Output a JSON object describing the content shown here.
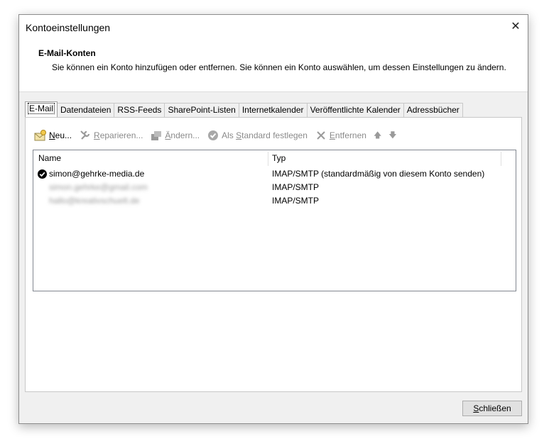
{
  "window": {
    "title": "Kontoeinstellungen",
    "close_glyph": "✕"
  },
  "header": {
    "title": "E-Mail-Konten",
    "description": "Sie können ein Konto hinzufügen oder entfernen. Sie können ein Konto auswählen, um dessen Einstellungen zu ändern."
  },
  "tabs": [
    {
      "label": "E-Mail",
      "active": true
    },
    {
      "label": "Datendateien"
    },
    {
      "label": "RSS-Feeds"
    },
    {
      "label": "SharePoint-Listen"
    },
    {
      "label": "Internetkalender"
    },
    {
      "label": "Veröffentlichte Kalender"
    },
    {
      "label": "Adressbücher"
    }
  ],
  "toolbar": {
    "new": {
      "ul": "N",
      "rest": "eu...",
      "icon": "new-account-icon",
      "enabled": true
    },
    "repair": {
      "ul": "R",
      "rest": "eparieren...",
      "icon": "wrench-icon",
      "enabled": false
    },
    "change": {
      "pre": "",
      "ul": "Ä",
      "rest": "ndern...",
      "icon": "change-icon",
      "enabled": false
    },
    "default": {
      "pre": "Als ",
      "ul": "S",
      "rest": "tandard festlegen",
      "icon": "checkmark-circle-icon",
      "enabled": false
    },
    "remove": {
      "ul": "E",
      "rest": "ntfernen",
      "icon": "x-icon",
      "enabled": false
    },
    "up_glyph": "🡅",
    "down_glyph": "🡇"
  },
  "list": {
    "columns": [
      "Name",
      "Typ"
    ],
    "rows": [
      {
        "name": "simon@gehrke-media.de",
        "type": "IMAP/SMTP (standardmäßig von diesem Konto senden)",
        "default": true
      },
      {
        "name": "simon.gehrke@gmail.com",
        "type": "IMAP/SMTP",
        "blurred": true
      },
      {
        "name": "hallo@kreativschuelt.de",
        "type": "IMAP/SMTP",
        "blurred": true
      }
    ]
  },
  "footer": {
    "close_ul": "S",
    "close_rest": "chließen"
  }
}
